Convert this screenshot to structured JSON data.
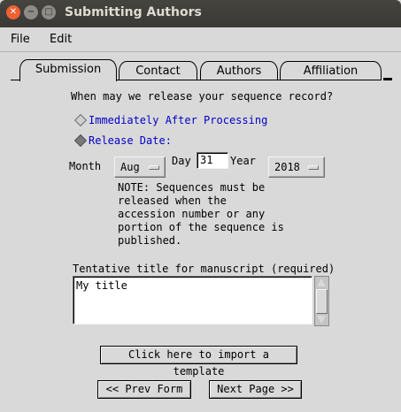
{
  "window": {
    "title": "Submitting Authors"
  },
  "menubar": {
    "file": "File",
    "edit": "Edit"
  },
  "tabs": [
    {
      "label": "Submission"
    },
    {
      "label": "Contact"
    },
    {
      "label": "Authors"
    },
    {
      "label": "Affiliation"
    }
  ],
  "release": {
    "question": "When may we release your sequence record?",
    "option_immediate": "Immediately After Processing",
    "option_date": "Release Date:",
    "selected": "Release Date:"
  },
  "date": {
    "month_label": "Month",
    "month_value": "Aug",
    "day_label": "Day",
    "day_value": "31",
    "year_label": "Year",
    "year_value": "2018"
  },
  "note": {
    "line1": "NOTE: Sequences must be",
    "line2": "released when the",
    "line3": "accession number or any",
    "line4": "portion of the sequence is",
    "line5": "published."
  },
  "manuscript": {
    "label": "Tentative title for manuscript (required)",
    "value": "My title"
  },
  "buttons": {
    "import_template": "Click here to import a template",
    "prev": "<< Prev Form",
    "next": "Next Page >>"
  }
}
